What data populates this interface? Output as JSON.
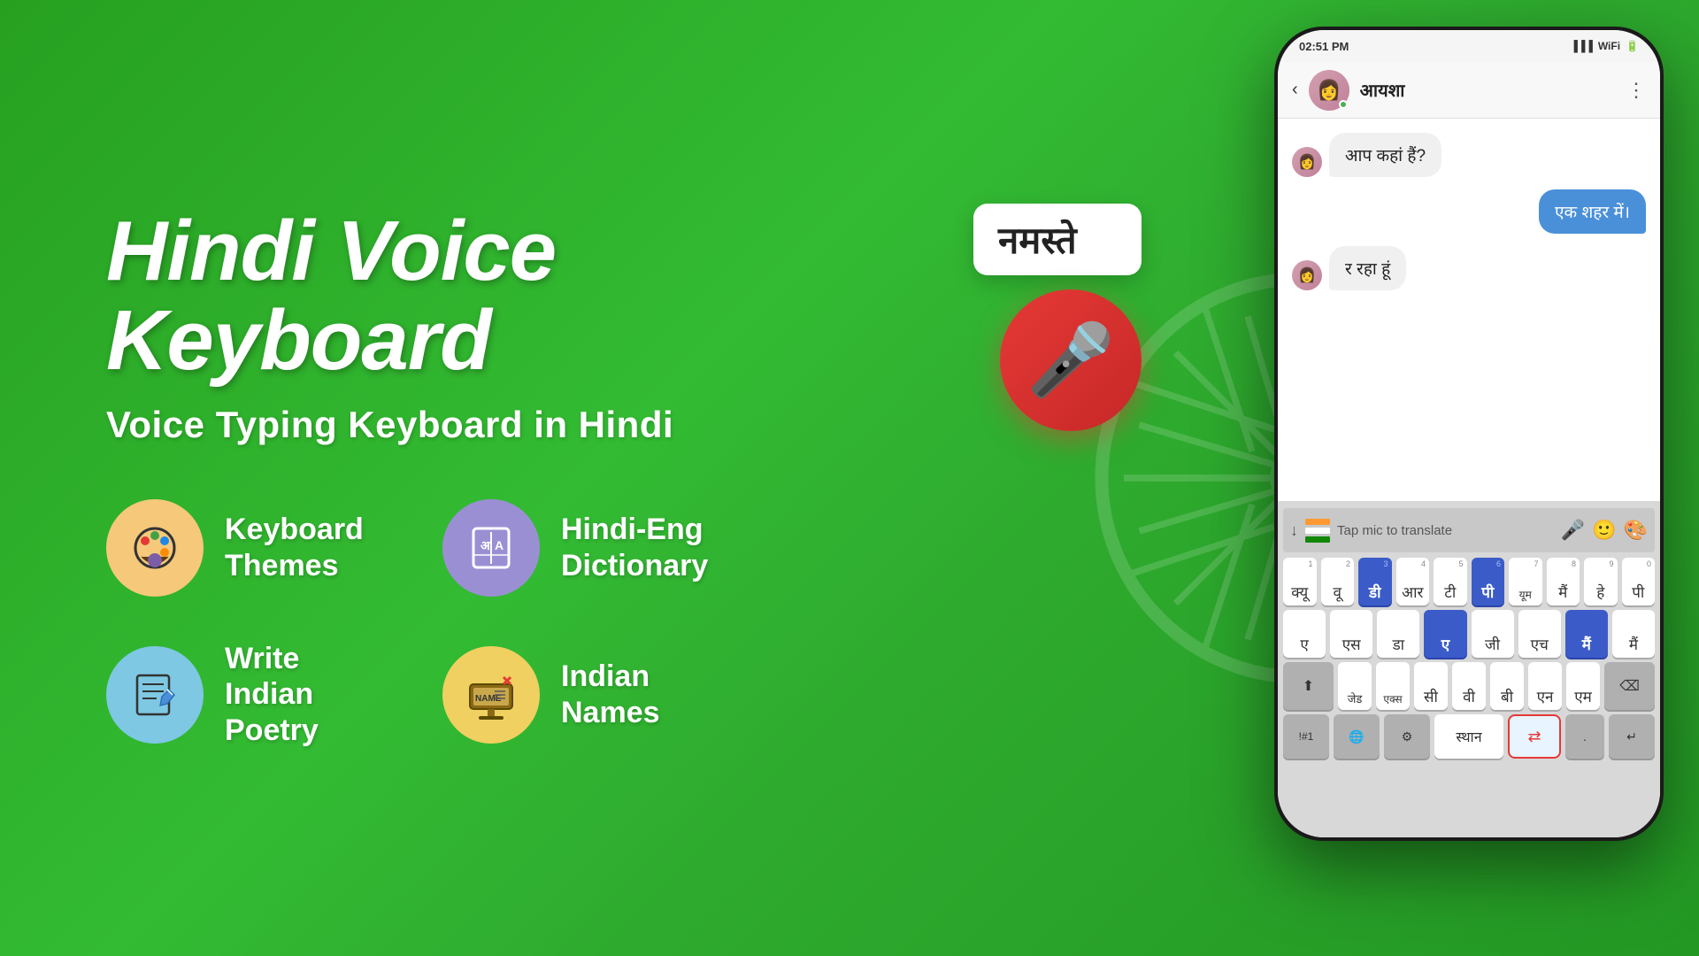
{
  "background": {
    "color1": "#27a020",
    "color2": "#33bb33"
  },
  "header": {
    "main_title": "Hindi Voice Keyboard",
    "sub_title": "Voice Typing Keyboard in Hindi"
  },
  "features": [
    {
      "id": "keyboard-themes",
      "label": "Keyboard\nThemes",
      "icon_color": "#f5c87a",
      "icon_type": "palette"
    },
    {
      "id": "hindi-eng-dictionary",
      "label": "Hindi-Eng\nDictionary",
      "icon_color": "#9b8fd4",
      "icon_type": "dictionary"
    },
    {
      "id": "write-indian-poetry",
      "label": "Write Indian\nPoetry",
      "icon_color": "#7ec8e3",
      "icon_type": "poetry"
    },
    {
      "id": "indian-names",
      "label": "Indian\nNames",
      "icon_color": "#f0d060",
      "icon_type": "names"
    }
  ],
  "phone": {
    "status_time": "02:51 PM",
    "chat_name": "आयशा",
    "messages": [
      {
        "type": "received",
        "text": "आप कहां हैं?"
      },
      {
        "type": "sent",
        "text": "एक शहर में।"
      },
      {
        "type": "received",
        "text": "र रहा हूं"
      }
    ],
    "namaste_bubble": "नमस्ते",
    "keyboard_hint": "Tap mic to translate",
    "space_label": "स्थान",
    "keyboard_rows": [
      {
        "keys": [
          {
            "char": "क्यू",
            "num": "1"
          },
          {
            "char": "वू",
            "num": "2"
          },
          {
            "char": "डी",
            "num": "3",
            "blue": true
          },
          {
            "char": "आर",
            "num": "4"
          },
          {
            "char": "टी",
            "num": "5"
          },
          {
            "char": "पी",
            "num": "6",
            "blue": true
          },
          {
            "char": "यूम",
            "num": "7"
          },
          {
            "char": "मैं",
            "num": "8"
          },
          {
            "char": "हे",
            "num": "9"
          },
          {
            "char": "पी",
            "num": "0"
          }
        ]
      },
      {
        "keys": [
          {
            "char": "ए",
            "num": ""
          },
          {
            "char": "एस",
            "num": ""
          },
          {
            "char": "डा",
            "num": ""
          },
          {
            "char": "ए",
            "num": "",
            "blue": true
          },
          {
            "char": "जी",
            "num": ""
          },
          {
            "char": "एच",
            "num": ""
          },
          {
            "char": "मैं",
            "num": "",
            "blue": true
          },
          {
            "char": "मैं",
            "num": ""
          }
        ]
      },
      {
        "keys": [
          {
            "char": "जेड",
            "num": ""
          },
          {
            "char": "एक्स",
            "num": ""
          },
          {
            "char": "सी",
            "num": ""
          },
          {
            "char": "वी",
            "num": ""
          },
          {
            "char": "बी",
            "num": ""
          },
          {
            "char": "एन",
            "num": ""
          },
          {
            "char": "एम",
            "num": ""
          }
        ]
      }
    ]
  }
}
